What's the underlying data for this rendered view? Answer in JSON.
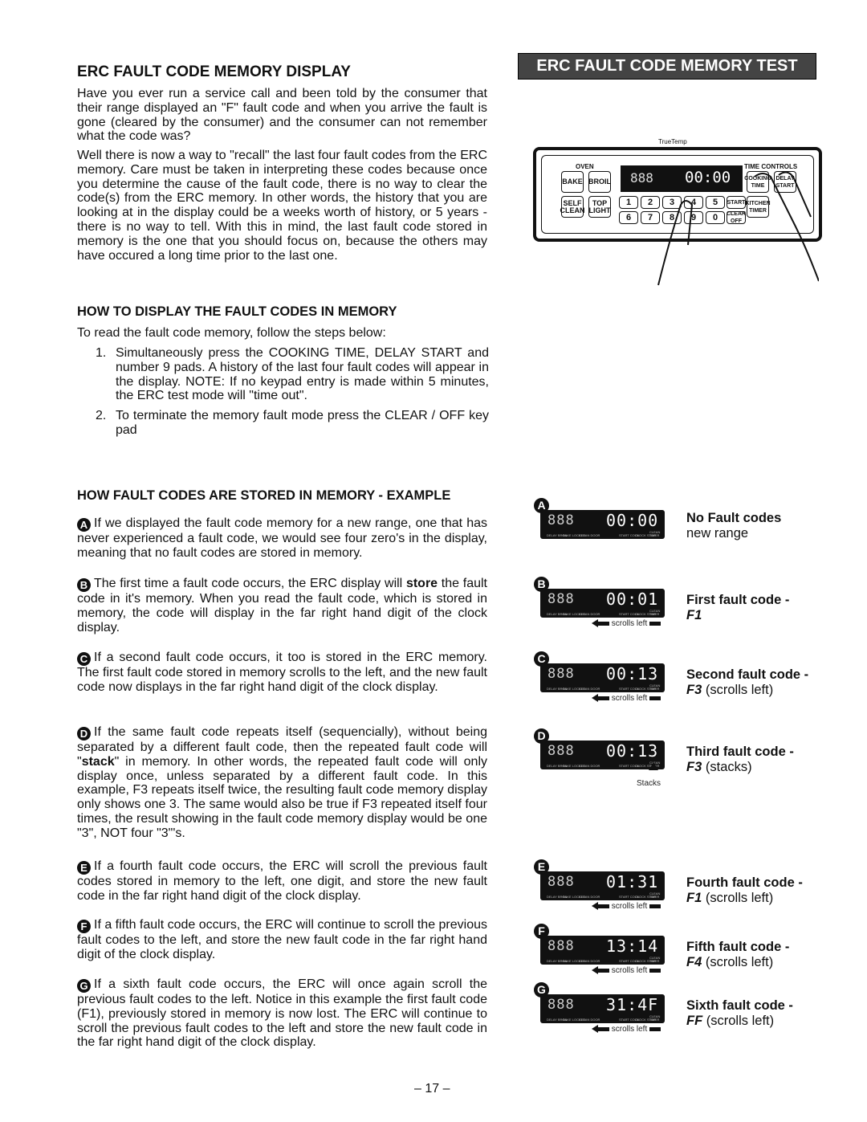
{
  "left": {
    "title": "ERC FAULT CODE MEMORY DISPLAY",
    "p1": "Have you ever run a service call and been told by the consumer that their range displayed an \"F\" fault code and when you arrive the fault is gone (cleared by the consumer) and the consumer can not remember what the code was?",
    "p2": "Well there is now a way to \"recall\" the last four fault codes from the ERC memory.  Care must be taken in interpreting these codes because once you determine the cause of the fault code, there is no way to clear the code(s) from the ERC memory.  In other words, the history that you are looking at in the display could be a weeks worth of history, or 5 years - there is no way to tell.  With this in mind, the last fault code stored in memory is the one that you should focus on, because the others may have occured a long time prior to the last one.",
    "h2": "HOW TO DISPLAY THE FAULT CODES IN MEMORY",
    "intro": "To read the fault code memory, follow the steps below:",
    "steps": [
      {
        "n": "1.",
        "t": "Simultaneously press the COOKING TIME, DELAY START and number 9 pads.  A history of the last four fault codes will appear in the display.  NOTE:  If no keypad entry is made within 5 minutes, the ERC test mode will \"time out\"."
      },
      {
        "n": "2.",
        "t": "To terminate the memory fault mode press the CLEAR / OFF key pad"
      }
    ],
    "h3": "HOW FAULT CODES ARE STORED IN MEMORY - EXAMPLE",
    "examples": [
      {
        "letter": "A",
        "pre": "If we displayed the fault code memory for a new range, one that has never experienced a fault code, we would see four zero's in the display, meaning that no fault codes are stored in memory."
      },
      {
        "letter": "B",
        "pre": "The first time a fault code occurs, the ERC display will ",
        "bold": "store",
        "post": " the fault code in it's memory.  When you read the fault code, which is stored in memory, the code will display in the far right hand digit of the clock display."
      },
      {
        "letter": "C",
        "pre": "If a second fault code occurs, it too is stored in the ERC memory.  The first fault code stored in memory scrolls to the left, and the new fault code now displays in the far right hand digit of the clock display."
      },
      {
        "letter": "D",
        "pre": "If the same fault code repeats itself (sequencially), without being separated by a different fault code, then the repeated fault code will \"",
        "bold": "stack",
        "post": "\" in memory.  In other words, the repeated fault code will only display once, unless separated by a different fault code.  In this example, F3 repeats itself twice, the resulting fault code memory display only shows one 3.  The same would also be true if F3 repeated itself four times, the result showing in the fault code memory display would be one \"3\", NOT four \"3\"'s."
      },
      {
        "letter": "E",
        "pre": "If a fourth fault code occurs, the ERC will scroll the previous fault codes stored in memory to the left, one digit, and store the new fault code in the far right hand digit of the clock display."
      },
      {
        "letter": "F",
        "pre": "If a fifth fault code occurs, the ERC will continue to scroll the previous fault codes to the left, and store the new fault code in the far right hand digit of the clock display."
      },
      {
        "letter": "G",
        "pre": "If a sixth fault code occurs, the ERC will once again scroll the previous fault codes to the left.  Notice in this example the first fault code (F1), previously stored in memory is now lost.  The ERC will continue to scroll the previous fault codes to the left and store the new fault code in the far right hand digit of the clock display."
      }
    ]
  },
  "right": {
    "banner": "ERC FAULT CODE MEMORY TEST",
    "brand": "TrueTemp",
    "panel": {
      "oven": "OVEN",
      "time_controls": "TIME CONTROLS",
      "bake": "BAKE",
      "broil": "BROIL",
      "self_clean": "SELF CLEAN",
      "top_light": "TOP LIGHT",
      "cooking_time": "COOKING TIME",
      "delay_start": "DELAY START",
      "kitchen_timer": "KITCHEN TIMER",
      "start": "START",
      "clear_off": "CLEAR OFF",
      "digits": [
        "1",
        "2",
        "3",
        "4",
        "5",
        "6",
        "7",
        "8",
        "9",
        "0"
      ],
      "display_left": "888",
      "display_clock": "00:00"
    },
    "displays": [
      {
        "letter": "A",
        "left": "888",
        "clock": "00:00",
        "note": "",
        "title": "No Fault codes",
        "sub_code": "",
        "sub": "new range"
      },
      {
        "letter": "B",
        "left": "888",
        "clock": "00:01",
        "note": "scrolls left",
        "title": "First fault code -",
        "sub_code": "F1",
        "sub": ""
      },
      {
        "letter": "C",
        "left": "888",
        "clock": "00:13",
        "note": "scrolls left",
        "title": "Second fault code -",
        "sub_code": "F3",
        "sub": "(scrolls left)"
      },
      {
        "letter": "D",
        "left": "888",
        "clock": "00:13",
        "note": "Stacks",
        "title": "Third fault code -",
        "sub_code": "F3",
        "sub": "(stacks)"
      },
      {
        "letter": "E",
        "left": "888",
        "clock": "01:31",
        "note": "scrolls left",
        "title": "Fourth fault code -",
        "sub_code": "F1",
        "sub": "(scrolls left)"
      },
      {
        "letter": "F",
        "left": "888",
        "clock": "13:14",
        "note": "scrolls left",
        "title": "Fifth fault code -",
        "sub_code": "F4",
        "sub": "(scrolls left)"
      },
      {
        "letter": "G",
        "left": "888",
        "clock": "31:4F",
        "note": "scrolls left",
        "title": "Sixth fault code -",
        "sub_code": "FF",
        "sub": "(scrolls left)"
      }
    ],
    "display_labels": {
      "delay_broil": "DELAY BROIL",
      "bake_locked": "BAKE LOCKED",
      "clean_door": "CLEAN DOOR",
      "start_cook": "START COOK",
      "clock_stop": "CLOCK STOP",
      "clean_timer": "CLEAN TIMER"
    }
  },
  "page_number": "– 17 –"
}
